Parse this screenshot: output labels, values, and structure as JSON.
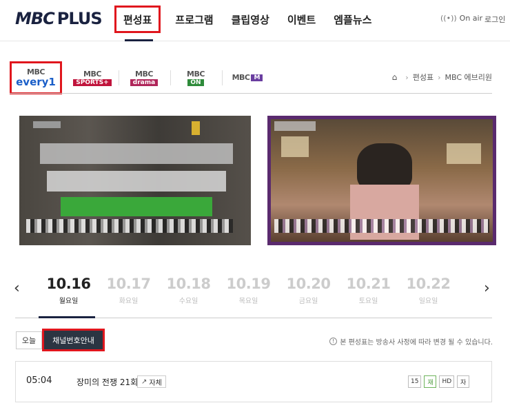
{
  "header": {
    "logo_mbc": "MBC",
    "logo_plus": "PLUS",
    "nav": [
      "편성표",
      "프로그램",
      "클립영상",
      "이벤트",
      "엠플뉴스"
    ],
    "onair": "On air",
    "login": "로그인"
  },
  "channels": {
    "items": [
      {
        "top": "MBC",
        "sub": "every1"
      },
      {
        "top": "MBC",
        "sub": "SPORTS+"
      },
      {
        "top": "MBC",
        "sub": "drama"
      },
      {
        "top": "MBC",
        "sub": "ON"
      },
      {
        "top": "MBC",
        "sub": "M"
      }
    ],
    "colors": {
      "sports": "#c0143c",
      "drama": "#b0265a",
      "on": "#2e8b3a",
      "m": "#6a3ea0"
    }
  },
  "breadcrumb": [
    "편성표",
    "MBC 에브리원"
  ],
  "dates": [
    {
      "d": "10.16",
      "w": "월요일"
    },
    {
      "d": "10.17",
      "w": "화요일"
    },
    {
      "d": "10.18",
      "w": "수요일"
    },
    {
      "d": "10.19",
      "w": "목요일"
    },
    {
      "d": "10.20",
      "w": "금요일"
    },
    {
      "d": "10.21",
      "w": "토요일"
    },
    {
      "d": "10.22",
      "w": "일요일"
    }
  ],
  "tools": {
    "today": "오늘",
    "channel_guide": "채널번호안내",
    "notice": "본 편성표는 방송사 사정에 따라 변경 될 수 있습니다."
  },
  "schedule": [
    {
      "time": "05:04",
      "title": "장미의 전쟁 21회",
      "link": "자체",
      "badges": [
        "15",
        "재",
        "HD",
        "자"
      ]
    }
  ]
}
